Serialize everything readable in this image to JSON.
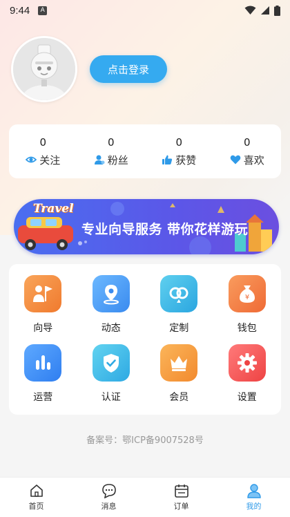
{
  "status_bar": {
    "time": "9:44",
    "notification_badge": "A"
  },
  "profile": {
    "login_button": "点击登录"
  },
  "stats": [
    {
      "value": "0",
      "label": "关注",
      "icon": "eye-icon",
      "color": "#2f9ae8"
    },
    {
      "value": "0",
      "label": "粉丝",
      "icon": "fans-user-icon",
      "color": "#2f9ae8"
    },
    {
      "value": "0",
      "label": "获赞",
      "icon": "thumbs-up-icon",
      "color": "#2f9ae8"
    },
    {
      "value": "0",
      "label": "喜欢",
      "icon": "heart-icon",
      "color": "#2f9ae8"
    }
  ],
  "banner": {
    "logo_text": "Travel",
    "slogan": "专业向导服务 带你花样游玩"
  },
  "services": [
    {
      "label": "向导",
      "icon": "guide-flag-icon",
      "color": "#f5883a"
    },
    {
      "label": "动态",
      "icon": "location-pin-icon",
      "color": "#3d9cf0"
    },
    {
      "label": "定制",
      "icon": "custom-link-icon",
      "color": "#3ab6e6"
    },
    {
      "label": "钱包",
      "icon": "wallet-moneybag-icon",
      "color": "#f27a3f"
    },
    {
      "label": "运营",
      "icon": "bar-chart-icon",
      "color": "#3d8ff0"
    },
    {
      "label": "认证",
      "icon": "shield-check-icon",
      "color": "#36b8e8"
    },
    {
      "label": "会员",
      "icon": "crown-icon",
      "color": "#f5a03a"
    },
    {
      "label": "设置",
      "icon": "gear-icon",
      "color": "#f04b4b"
    }
  ],
  "footer": {
    "icp": "备案号：鄂ICP备9007528号"
  },
  "tabbar": {
    "active": "我的",
    "tabs": [
      {
        "label": "首页",
        "icon": "home-icon"
      },
      {
        "label": "消息",
        "icon": "message-icon"
      },
      {
        "label": "订单",
        "icon": "order-calendar-icon"
      },
      {
        "label": "我的",
        "icon": "profile-icon"
      }
    ]
  }
}
